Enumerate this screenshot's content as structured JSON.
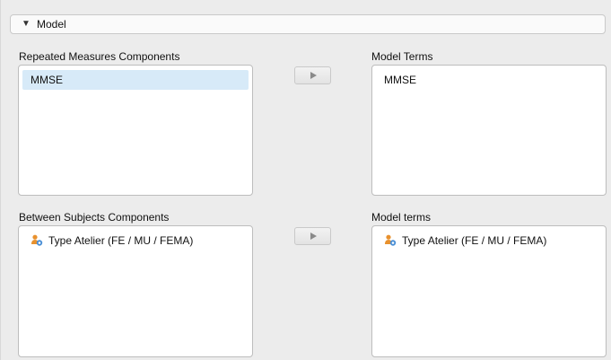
{
  "section": {
    "caret": "▼",
    "title": "Model"
  },
  "repeated_measures": {
    "label": "Repeated Measures Components",
    "items": [
      {
        "text": "MMSE",
        "selected": true
      }
    ]
  },
  "model_terms_top": {
    "label": "Model Terms",
    "items": [
      {
        "text": "MMSE"
      }
    ]
  },
  "between_subjects": {
    "label": "Between Subjects Components",
    "items": [
      {
        "text": "Type Atelier (FE / MU / FEMA)",
        "icon": "nominal-variable-icon"
      }
    ]
  },
  "model_terms_bottom": {
    "label": "Model terms",
    "items": [
      {
        "text": "Type Atelier (FE / MU / FEMA)",
        "icon": "nominal-variable-icon"
      }
    ]
  },
  "colors": {
    "selection": "#d7eaf8",
    "icon_orange": "#e8912d",
    "icon_blue": "#4a8fd6"
  }
}
